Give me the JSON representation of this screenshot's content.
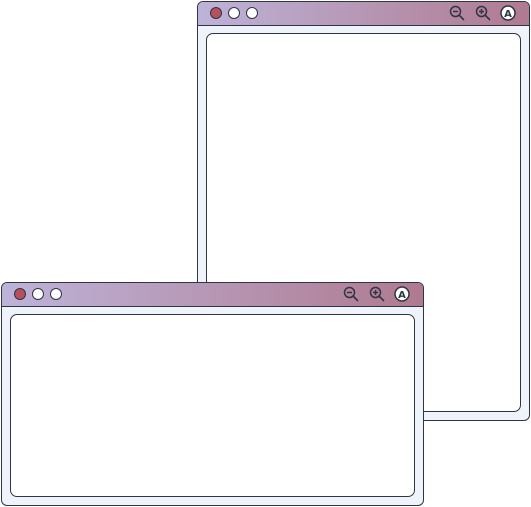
{
  "colors": {
    "background": "#ffffff",
    "stroke": "#2e3546",
    "window_frame": "#eef4f9",
    "titlebar_gradient_start": "#bdb3d8",
    "titlebar_gradient_end": "#b07a90",
    "close_dot": "#b7505e"
  },
  "windows": [
    {
      "id": "back",
      "controls": [
        "close-dot",
        "minimize-dot",
        "maximize-dot"
      ],
      "toolbar_icons": [
        "zoom-out-icon",
        "zoom-in-icon",
        "font-icon"
      ],
      "font_icon_glyph": "A"
    },
    {
      "id": "front",
      "controls": [
        "close-dot",
        "minimize-dot",
        "maximize-dot"
      ],
      "toolbar_icons": [
        "zoom-out-icon",
        "zoom-in-icon",
        "font-icon"
      ],
      "font_icon_glyph": "A"
    }
  ]
}
